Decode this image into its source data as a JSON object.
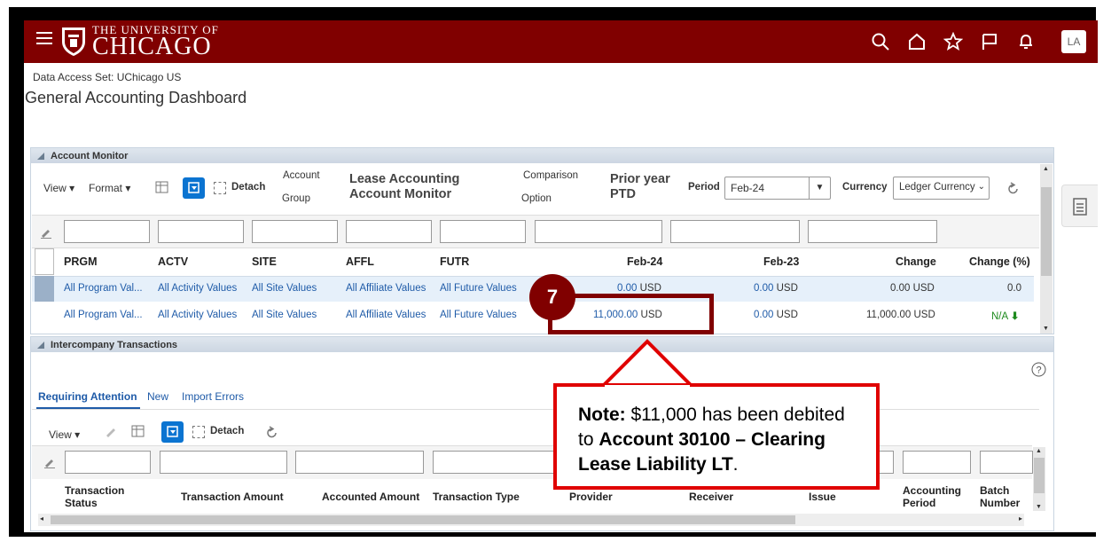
{
  "header": {
    "logo_small": "THE UNIVERSITY OF",
    "logo_big": "CHICAGO",
    "avatar": "LA",
    "icons": [
      "search-icon",
      "home-icon",
      "star-icon",
      "flag-icon",
      "bell-icon"
    ]
  },
  "data_access_set": "Data Access Set: UChicago US",
  "page_title": "General Accounting Dashboard",
  "account_monitor": {
    "title": "Account Monitor",
    "toolbar": {
      "view": "View",
      "format": "Format",
      "detach": "Detach",
      "account_group_l1": "Account",
      "account_group_l2": "Group",
      "account_group_value_l1": "Lease Accounting",
      "account_group_value_l2": "Account Monitor",
      "comparison_l1": "Comparison",
      "comparison_l2": "Option",
      "comparison_value_l1": "Prior year",
      "comparison_value_l2": "PTD",
      "period_label": "Period",
      "period_value": "Feb-24",
      "currency_label": "Currency",
      "currency_value": "Ledger Currency"
    },
    "columns": [
      "PRGM",
      "ACTV",
      "SITE",
      "AFFL",
      "FUTR",
      "Feb-24",
      "Feb-23",
      "Change",
      "Change (%)"
    ],
    "rows": [
      {
        "prgm": "All Program Val...",
        "actv": "All Activity Values",
        "site": "All Site Values",
        "affl": "All Affiliate Values",
        "futr": "All Future Values",
        "cur_amt": "0.00",
        "cur_ccy": "USD",
        "prior_amt": "0.00",
        "prior_ccy": "USD",
        "change": "0.00 USD",
        "pct": "0.0"
      },
      {
        "prgm": "All Program Val...",
        "actv": "All Activity Values",
        "site": "All Site Values",
        "affl": "All Affiliate Values",
        "futr": "All Future Values",
        "cur_amt": "11,000.00",
        "cur_ccy": "USD",
        "prior_amt": "0.00",
        "prior_ccy": "USD",
        "change": "11,000.00 USD",
        "pct": "N/A"
      }
    ]
  },
  "intercompany": {
    "title": "Intercompany Transactions",
    "tabs": [
      "Requiring Attention",
      "New",
      "Import Errors"
    ],
    "toolbar": {
      "view": "View",
      "detach": "Detach"
    },
    "columns": [
      {
        "l1": "Transaction",
        "l2": "Status"
      },
      {
        "l1": "Transaction Amount",
        "l2": ""
      },
      {
        "l1": "Accounted Amount",
        "l2": ""
      },
      {
        "l1": "Transaction Type",
        "l2": ""
      },
      {
        "l1": "Provider",
        "l2": ""
      },
      {
        "l1": "Receiver",
        "l2": ""
      },
      {
        "l1": "Issue",
        "l2": ""
      },
      {
        "l1": "Accounting",
        "l2": "Period"
      },
      {
        "l1": "Batch",
        "l2": "Number"
      }
    ]
  },
  "callout": {
    "step": "7",
    "note_label": "Note:",
    "text1": " $11,000 has been debited to ",
    "account": "Account 30100 – Clearing Lease Liability LT",
    "end": "."
  },
  "colors": {
    "brand": "#800000",
    "accent_blue": "#0b74d1",
    "callout_red": "#e00000",
    "link": "#1f5ba8",
    "green": "#1d8a1d"
  }
}
